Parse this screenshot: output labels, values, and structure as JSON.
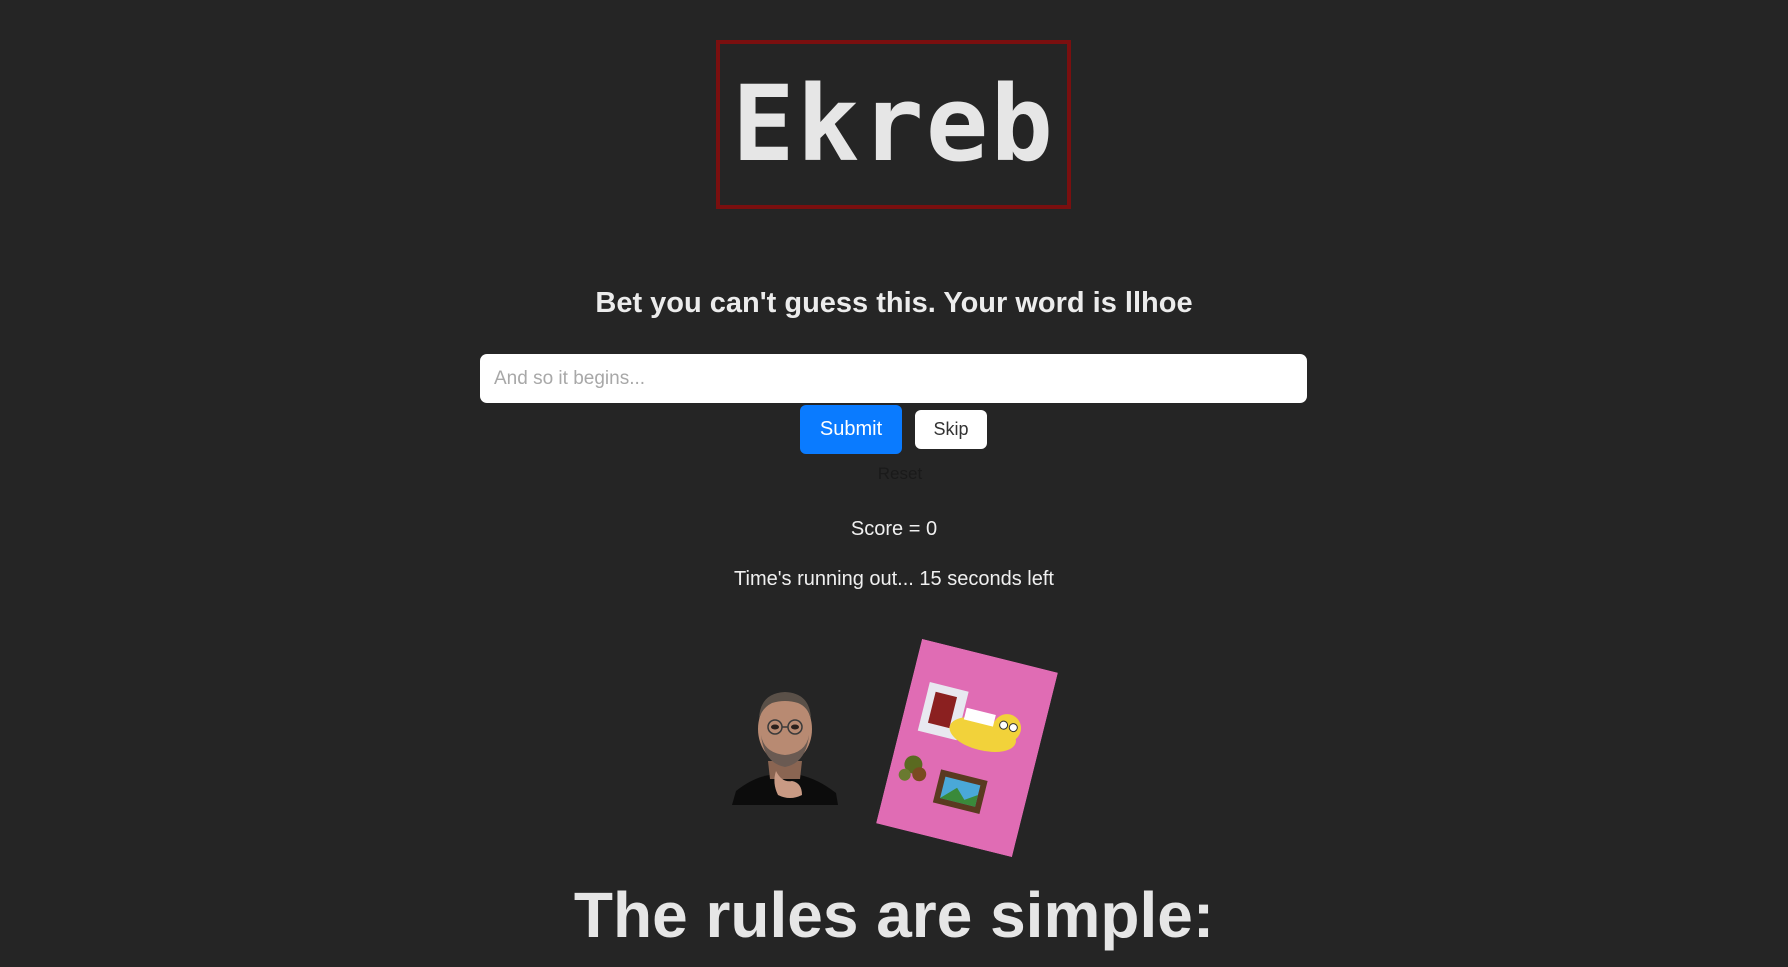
{
  "logo": {
    "text": "Ekreb"
  },
  "game": {
    "prompt": "Bet you can't guess this. Your word is llhoe",
    "input_placeholder": "And so it begins...",
    "input_value": "",
    "submit_label": "Submit",
    "skip_label": "Skip",
    "reset_label": "Reset",
    "score_text": "Score = 0",
    "timer_text": "Time's running out... 15 seconds left"
  },
  "images": [
    {
      "icon": "portrait-image"
    },
    {
      "icon": "cartoon-poster-image"
    }
  ],
  "rules": {
    "title": "The rules are simple:"
  },
  "colors": {
    "background": "#252525",
    "accent": "#0a7bff",
    "logo_border": "#7a0f0f"
  }
}
